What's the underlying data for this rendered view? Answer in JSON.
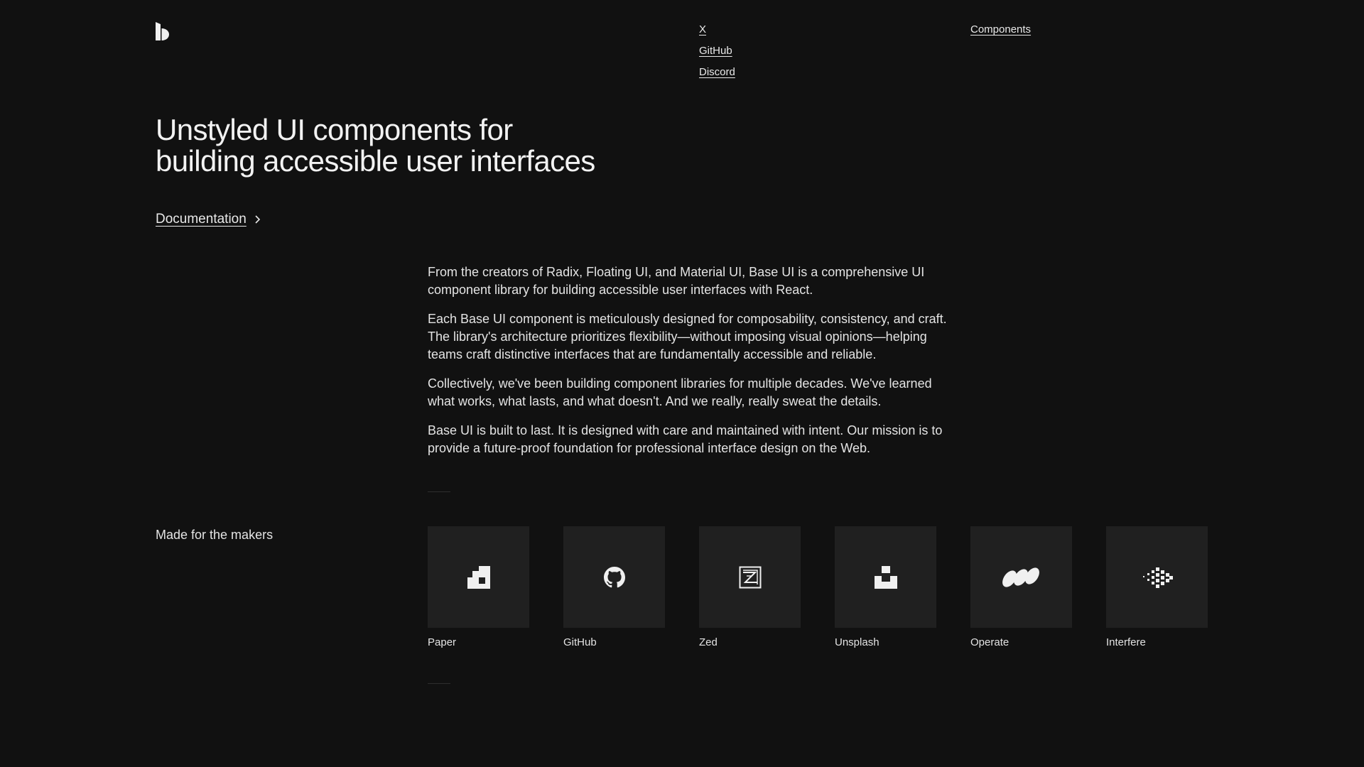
{
  "header": {
    "social_links": [
      "X",
      "GitHub",
      "Discord"
    ],
    "nav_link": "Components"
  },
  "hero": {
    "title_line1": "Unstyled UI components for",
    "title_line2": "building accessible user interfaces",
    "cta_label": "Documentation"
  },
  "intro": {
    "paragraphs": [
      "From the creators of Radix, Floating UI, and Material UI, Base UI is a comprehensive UI component library for building accessible user interfaces with React.",
      "Each Base UI component is meticulously designed for composability, consistency, and craft. The library's architecture prioritizes flexibility—without imposing visual opinions—helping teams craft distinctive interfaces that are fundamentally accessible and reliable.",
      "Collectively, we've been building component libraries for multiple decades. We've learned what works, what lasts, and what doesn't. And we really, really sweat the details.",
      "Base UI is built to last. It is designed with care and maintained with intent. Our mission is to provide a future-proof foundation for professional interface design on the Web."
    ]
  },
  "makers": {
    "label": "Made for the makers",
    "items": [
      {
        "name": "Paper",
        "icon": "paper-logo-icon"
      },
      {
        "name": "GitHub",
        "icon": "github-logo-icon"
      },
      {
        "name": "Zed",
        "icon": "zed-logo-icon"
      },
      {
        "name": "Unsplash",
        "icon": "unsplash-logo-icon"
      },
      {
        "name": "Operate",
        "icon": "operate-logo-icon"
      },
      {
        "name": "Interfere",
        "icon": "interfere-logo-icon"
      }
    ]
  },
  "colors": {
    "background": "#111111",
    "text": "#e9e9e9",
    "tile": "#202020"
  }
}
